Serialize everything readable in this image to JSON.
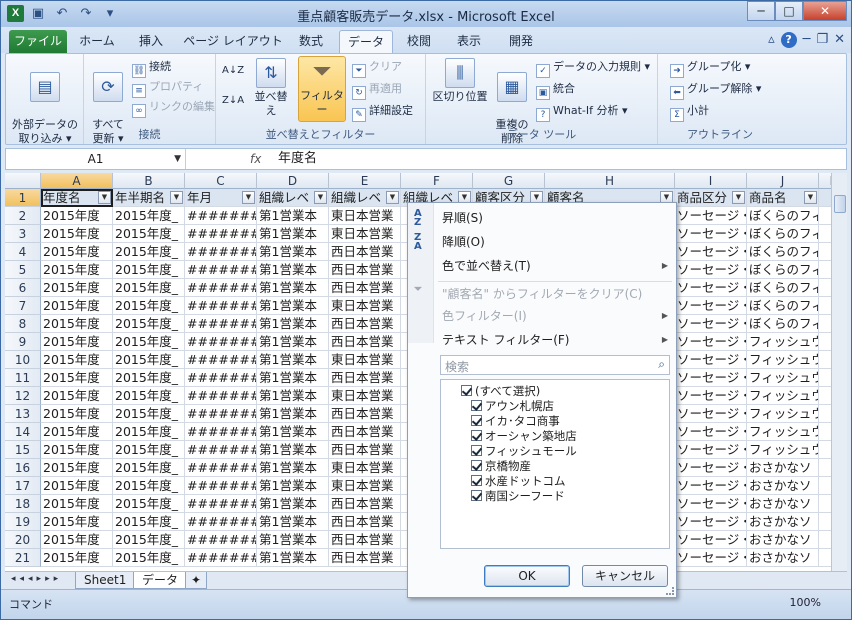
{
  "window": {
    "title": "重点顧客販売データ.xlsx - Microsoft Excel"
  },
  "tabs": {
    "file": "ファイル",
    "items": [
      "ホーム",
      "挿入",
      "ページ レイアウト",
      "数式",
      "データ",
      "校閲",
      "表示",
      "開発"
    ],
    "active": "データ"
  },
  "ribbon": {
    "external": {
      "label": "外部データの\n取り込み ▾"
    },
    "connect": {
      "refresh": "すべて\n更新 ▾",
      "connections": "接続",
      "properties": "プロパティ",
      "edit_links": "リンクの編集",
      "group": "接続"
    },
    "sort": {
      "sort_az": "A↓Z",
      "sort_za": "Z↓A",
      "sort_label": "並べ替え",
      "filter": "フィルター",
      "clear": "クリア",
      "reapply": "再適用",
      "advanced": "詳細設定",
      "group": "並べ替えとフィルター"
    },
    "tools": {
      "text_to_columns": "区切り位置",
      "remove_dup": "重複の\n削除",
      "validation": "データの入力規則 ▾",
      "consolidate": "統合",
      "whatif": "What-If 分析 ▾",
      "group": "データ ツール"
    },
    "outline": {
      "group_btn": "グループ化 ▾",
      "ungroup": "グループ解除 ▾",
      "subtotal": "小計",
      "group": "アウトライン"
    }
  },
  "formula": {
    "name_box": "A1",
    "fx": "fx",
    "value": "年度名"
  },
  "grid": {
    "columns": [
      "A",
      "B",
      "C",
      "D",
      "E",
      "F",
      "G",
      "H",
      "I",
      "J",
      "K"
    ],
    "headers": [
      "年度名",
      "年半期名",
      "年月",
      "組織レベ",
      "組織レベ",
      "組織レベ",
      "顧客区分",
      "顧客名",
      "商品区分",
      "商品名",
      ""
    ],
    "rows": [
      [
        "1",
        "年度名",
        "年半期名",
        "年月",
        "組織レベ",
        "組織レベ",
        "組織レベ",
        "顧客区分",
        "顧客名",
        "商品区分",
        "商品名",
        ""
      ],
      [
        "2",
        "2015年度",
        "2015年度_",
        "########",
        "第1営業本",
        "東日本営業",
        "",
        "",
        "",
        "ソーセージ・",
        "ぼくらのフィ",
        ""
      ],
      [
        "3",
        "2015年度",
        "2015年度_",
        "########",
        "第1営業本",
        "東日本営業",
        "",
        "",
        "",
        "ソーセージ・",
        "ぼくらのフィ",
        ""
      ],
      [
        "4",
        "2015年度",
        "2015年度_",
        "########",
        "第1営業本",
        "西日本営業",
        "",
        "",
        "",
        "ソーセージ・",
        "ぼくらのフィ",
        ""
      ],
      [
        "5",
        "2015年度",
        "2015年度_",
        "########",
        "第1営業本",
        "西日本営業",
        "",
        "",
        "",
        "ソーセージ・",
        "ぼくらのフィ",
        ""
      ],
      [
        "6",
        "2015年度",
        "2015年度_",
        "########",
        "第1営業本",
        "西日本営業",
        "",
        "",
        "",
        "ソーセージ・",
        "ぼくらのフィ",
        ""
      ],
      [
        "7",
        "2015年度",
        "2015年度_",
        "########",
        "第1営業本",
        "東日本営業",
        "",
        "",
        "",
        "ソーセージ・",
        "ぼくらのフィ",
        ""
      ],
      [
        "8",
        "2015年度",
        "2015年度_",
        "########",
        "第1営業本",
        "西日本営業",
        "",
        "",
        "",
        "ソーセージ・",
        "ぼくらのフィ",
        ""
      ],
      [
        "9",
        "2015年度",
        "2015年度_",
        "########",
        "第1営業本",
        "西日本営業",
        "",
        "",
        "",
        "ソーセージ・",
        "フィッシュウ",
        ""
      ],
      [
        "10",
        "2015年度",
        "2015年度_",
        "########",
        "第1営業本",
        "東日本営業",
        "",
        "",
        "",
        "ソーセージ・",
        "フィッシュウ",
        ""
      ],
      [
        "11",
        "2015年度",
        "2015年度_",
        "########",
        "第1営業本",
        "西日本営業",
        "",
        "",
        "",
        "ソーセージ・",
        "フィッシュウ",
        ""
      ],
      [
        "12",
        "2015年度",
        "2015年度_",
        "########",
        "第1営業本",
        "東日本営業",
        "",
        "",
        "",
        "ソーセージ・",
        "フィッシュウ",
        ""
      ],
      [
        "13",
        "2015年度",
        "2015年度_",
        "########",
        "第1営業本",
        "西日本営業",
        "",
        "",
        "",
        "ソーセージ・",
        "フィッシュウ",
        ""
      ],
      [
        "14",
        "2015年度",
        "2015年度_",
        "########",
        "第1営業本",
        "西日本営業",
        "",
        "",
        "",
        "ソーセージ・",
        "フィッシュウ",
        ""
      ],
      [
        "15",
        "2015年度",
        "2015年度_",
        "########",
        "第1営業本",
        "西日本営業",
        "",
        "",
        "",
        "ソーセージ・",
        "フィッシュウ",
        ""
      ],
      [
        "16",
        "2015年度",
        "2015年度_",
        "########",
        "第1営業本",
        "東日本営業",
        "",
        "",
        "",
        "ソーセージ・",
        "おさかなソ",
        ""
      ],
      [
        "17",
        "2015年度",
        "2015年度_",
        "########",
        "第1営業本",
        "東日本営業",
        "",
        "",
        "",
        "ソーセージ・",
        "おさかなソ",
        ""
      ],
      [
        "18",
        "2015年度",
        "2015年度_",
        "########",
        "第1営業本",
        "西日本営業",
        "",
        "",
        "",
        "ソーセージ・",
        "おさかなソ",
        ""
      ],
      [
        "19",
        "2015年度",
        "2015年度_",
        "########",
        "第1営業本",
        "西日本営業",
        "",
        "",
        "",
        "ソーセージ・",
        "おさかなソ",
        ""
      ],
      [
        "20",
        "2015年度",
        "2015年度_",
        "########",
        "第1営業本",
        "西日本営業",
        "",
        "",
        "",
        "ソーセージ・",
        "おさかなソ",
        ""
      ],
      [
        "21",
        "2015年度",
        "2015年度_",
        "########",
        "第1営業本",
        "西日本営業",
        "",
        "",
        "",
        "ソーセージ・",
        "おさかなソ",
        ""
      ]
    ]
  },
  "filter_menu": {
    "sort_asc": "昇順(S)",
    "sort_desc": "降順(O)",
    "sort_color": "色で並べ替え(T)",
    "clear_filter": "\"顧客名\" からフィルターをクリア(C)",
    "color_filter": "色フィルター(I)",
    "text_filter": "テキスト フィルター(F)",
    "search_placeholder": "検索",
    "items": [
      "(すべて選択)",
      "アウン札幌店",
      "イカ･タコ商事",
      "オーシャン築地店",
      "フィッシュモール",
      "京橋物産",
      "水産ドットコム",
      "南国シーフード"
    ],
    "ok": "OK",
    "cancel": "キャンセル"
  },
  "sheets": [
    "Sheet1",
    "データ"
  ],
  "status": {
    "mode": "コマンド",
    "zoom": "100%"
  }
}
